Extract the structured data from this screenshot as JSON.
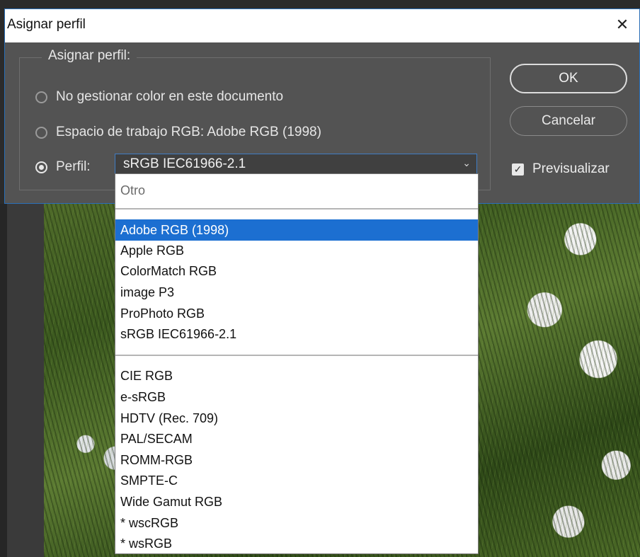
{
  "dialog": {
    "title": "Asignar perfil",
    "group_legend": "Asignar perfil:",
    "options": [
      {
        "label": "No gestionar color en este documento",
        "checked": false
      },
      {
        "label": "Espacio de trabajo RGB: Adobe RGB (1998)",
        "checked": false
      },
      {
        "label": "Perfil:",
        "checked": true
      }
    ],
    "profile_select": {
      "value": "sRGB IEC61966-2.1"
    },
    "buttons": {
      "ok": "OK",
      "cancel": "Cancelar"
    },
    "preview": {
      "label": "Previsualizar",
      "checked": true
    }
  },
  "dropdown": {
    "header": "Otro",
    "group1": [
      "Adobe RGB (1998)",
      "Apple RGB",
      "ColorMatch RGB",
      "image P3",
      "ProPhoto RGB",
      "sRGB IEC61966-2.1"
    ],
    "group2": [
      "CIE RGB",
      "e-sRGB",
      "HDTV (Rec. 709)",
      "PAL/SECAM",
      "ROMM-RGB",
      "SMPTE-C",
      "Wide Gamut RGB",
      "* wscRGB",
      "* wsRGB"
    ],
    "highlighted": "Adobe RGB (1998)"
  },
  "colors": {
    "dialog_bg": "#535353",
    "accent": "#1c6fd1",
    "select_border": "#3f7cc4"
  }
}
